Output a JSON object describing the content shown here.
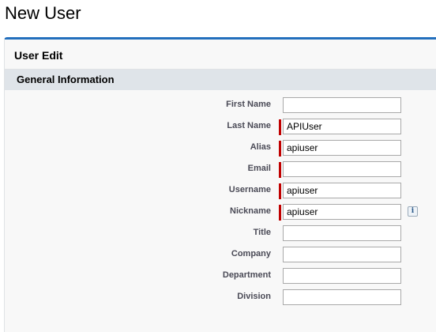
{
  "page": {
    "title": "New User"
  },
  "panel": {
    "title": "User Edit"
  },
  "section": {
    "title": "General Information"
  },
  "fields": [
    {
      "label": "First Name",
      "value": "",
      "required": false
    },
    {
      "label": "Last Name",
      "value": "APIUser",
      "required": true
    },
    {
      "label": "Alias",
      "value": "apiuser",
      "required": true
    },
    {
      "label": "Email",
      "value": "",
      "required": true
    },
    {
      "label": "Username",
      "value": "apiuser",
      "required": true
    },
    {
      "label": "Nickname",
      "value": "apiuser",
      "required": true,
      "info_icon": "info-icon"
    },
    {
      "label": "Title",
      "value": "",
      "required": false
    },
    {
      "label": "Company",
      "value": "",
      "required": false
    },
    {
      "label": "Department",
      "value": "",
      "required": false
    },
    {
      "label": "Division",
      "value": "",
      "required": false
    }
  ],
  "icons": {
    "info_glyph": "i"
  },
  "colors": {
    "accent": "#236fbd",
    "required": "#c00000",
    "section_bg": "#dfe4e9",
    "panel_bg": "#f8f8f8"
  }
}
